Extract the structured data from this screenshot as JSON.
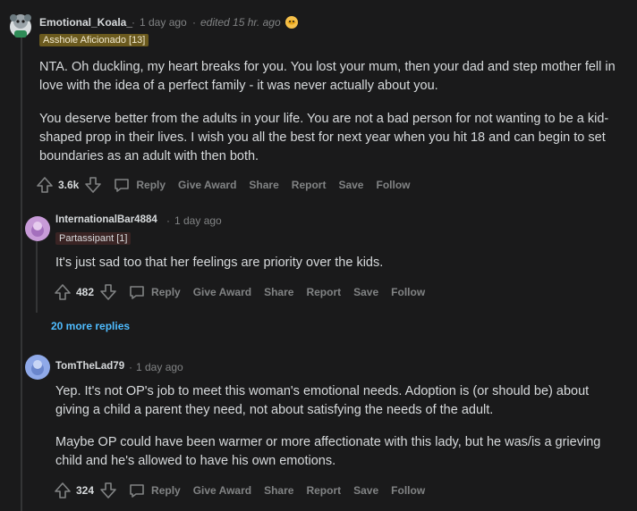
{
  "comments": [
    {
      "username": "Emotional_Koala_",
      "time": "1 day ago",
      "edited": "edited 15 hr. ago",
      "flair": "Asshole Aficionado [13]",
      "paragraphs": [
        "NTA. Oh duckling, my heart breaks for you. You lost your mum, then your dad and step mother fell in love with the idea of a perfect family - it was never actually about you.",
        "You deserve better from the adults in your life. You are not a bad person for not wanting to be a kid-shaped prop in their lives. I wish you all the best for next year when you hit 18 and can begin to set boundaries as an adult with then both."
      ],
      "score": "3.6k"
    },
    {
      "username": "InternationalBar4884",
      "time": "1 day ago",
      "flair": "Partassipant [1]",
      "paragraphs": [
        "It's just sad too that her feelings are priority over the kids."
      ],
      "score": "482"
    },
    {
      "username": "TomTheLad79",
      "time": "1 day ago",
      "paragraphs": [
        "Yep. It's not OP's job to meet this woman's emotional needs. Adoption is (or should be) about giving a child a parent they need, not about satisfying the needs of the adult.",
        "Maybe OP could have been warmer or more affectionate with this lady, but he was/is a grieving child and he's allowed to have his own emotions."
      ],
      "score": "324"
    }
  ],
  "actions": {
    "reply": "Reply",
    "give_award": "Give Award",
    "share": "Share",
    "report": "Report",
    "save": "Save",
    "follow": "Follow"
  },
  "more_replies": "20 more replies",
  "separator": "·",
  "colors": {
    "background": "#1a1a1b",
    "flair_gold": "#6b5a1e",
    "flair_dark": "#3a2424",
    "link": "#4fbcff"
  },
  "icons": [
    "snoo-avatar",
    "award-icon",
    "upvote-icon",
    "downvote-icon",
    "comment-icon"
  ]
}
